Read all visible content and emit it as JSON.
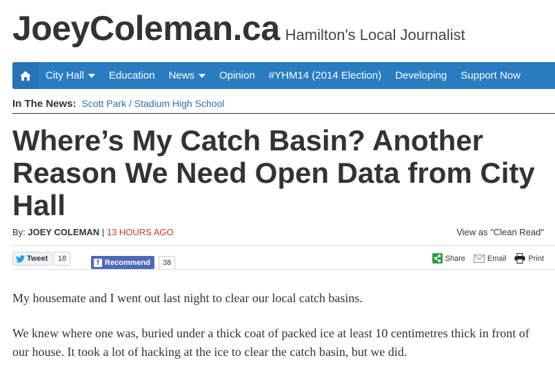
{
  "site": {
    "logo": "JoeyColeman.ca",
    "tagline": "Hamilton's Local Journalist"
  },
  "nav": {
    "home_icon": "home-icon",
    "items": [
      {
        "label": "City Hall",
        "dropdown": true
      },
      {
        "label": "Education",
        "dropdown": false
      },
      {
        "label": "News",
        "dropdown": true
      },
      {
        "label": "Opinion",
        "dropdown": false
      },
      {
        "label": "#YHM14 (2014 Election)",
        "dropdown": false
      },
      {
        "label": "Developing",
        "dropdown": false
      },
      {
        "label": "Support Now",
        "dropdown": false
      }
    ]
  },
  "in_the_news": {
    "label": "In The News:",
    "link": "Scott Park / Stadium High School"
  },
  "article": {
    "title": "Where’s My Catch Basin? Another Reason We Need Open Data from City Hall",
    "by_label": "By:",
    "author": "JOEY COLEMAN",
    "separator": "|",
    "time": "13 HOURS AGO",
    "clean_read": "View as \"Clean Read\"",
    "paragraphs": [
      "My housemate and I went out last night to clear our local catch basins.",
      "We knew where one was, buried under a thick coat of packed ice at least 10 centimetres thick in front of our house. It took a lot of hacking at the ice to clear the catch basin, but we did."
    ]
  },
  "social": {
    "tweet_label": "Tweet",
    "tweet_count": "18",
    "fb_label": "Recommend",
    "fb_count": "38",
    "share_label": "Share",
    "email_label": "Email",
    "print_label": "Print"
  },
  "colors": {
    "nav_blue": "#2a7cc1",
    "link_blue": "#2a6eb0",
    "time_red": "#c0392b",
    "facebook": "#4c69ba",
    "share_green": "#2e9e3e"
  }
}
